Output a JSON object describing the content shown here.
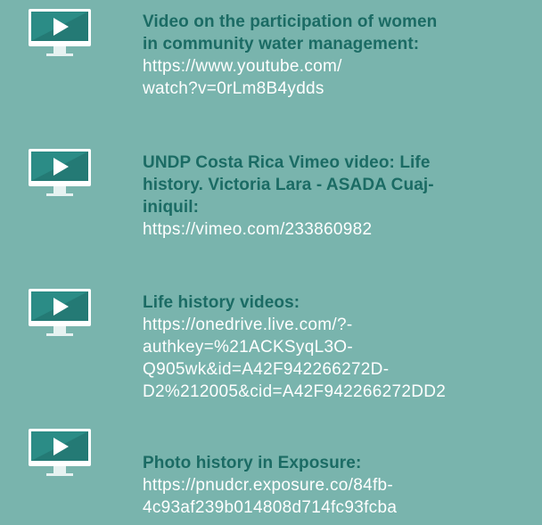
{
  "entries": [
    {
      "icon": "video-monitor-icon",
      "title_lines": [
        "Video on the participation of women",
        "in community water management:"
      ],
      "link_lines": [
        "https://www.youtube.com/",
        "watch?v=0rLm8B4ydds"
      ]
    },
    {
      "icon": "video-monitor-icon",
      "title_lines": [
        "UNDP Costa Rica Vimeo video: Life",
        "history. Victoria Lara - ASADA Cuaj-",
        "iniquil:"
      ],
      "link_lines": [
        "https://vimeo.com/233860982"
      ]
    },
    {
      "icon": "video-monitor-icon",
      "title_lines": [
        "Life history videos:"
      ],
      "link_lines": [
        "https://onedrive.live.com/?-",
        "authkey=%21ACKSyqL3O-",
        "Q905wk&id=A42F942266272D-",
        "D2%212005&cid=A42F942266272DD2"
      ]
    },
    {
      "icon": "video-monitor-icon",
      "title_lines": [
        "Photo history in Exposure:"
      ],
      "link_lines": [
        "https://pnudcr.exposure.co/84fb-",
        "4c93af239b014808d714fc93fcba"
      ]
    }
  ],
  "colors": {
    "background": "#79b4ad",
    "title": "#1b6b64",
    "link": "#ffffff",
    "screen": "#2b8c86",
    "stand": "#e6f2f1"
  }
}
